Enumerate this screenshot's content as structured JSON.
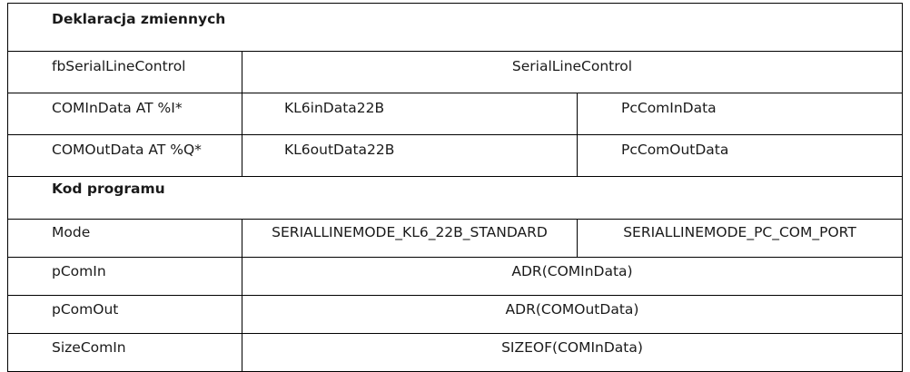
{
  "sections": {
    "declarations_title": "Deklaracja zmiennych",
    "program_title": "Kod programu"
  },
  "declarations": {
    "fb": {
      "name": "fbSerialLineControl",
      "type": "SerialLineControl"
    },
    "com_in": {
      "name": "COMInData AT %I*",
      "kl6": "KL6inData22B",
      "pc": "PcComInData"
    },
    "com_out": {
      "name": "COMOutData AT %Q*",
      "kl6": "KL6outData22B",
      "pc": "PcComOutData"
    }
  },
  "program": {
    "mode": {
      "name": "Mode",
      "kl6": "SERIALLINEMODE_KL6_22B_STANDARD",
      "pc": "SERIALLINEMODE_PC_COM_PORT"
    },
    "p_com_in": {
      "name": "pComIn",
      "value": "ADR(COMInData)"
    },
    "p_com_out": {
      "name": "pComOut",
      "value": "ADR(COMOutData)"
    },
    "size_com_in": {
      "name": "SizeComIn",
      "value": "SIZEOF(COMInData)"
    }
  }
}
